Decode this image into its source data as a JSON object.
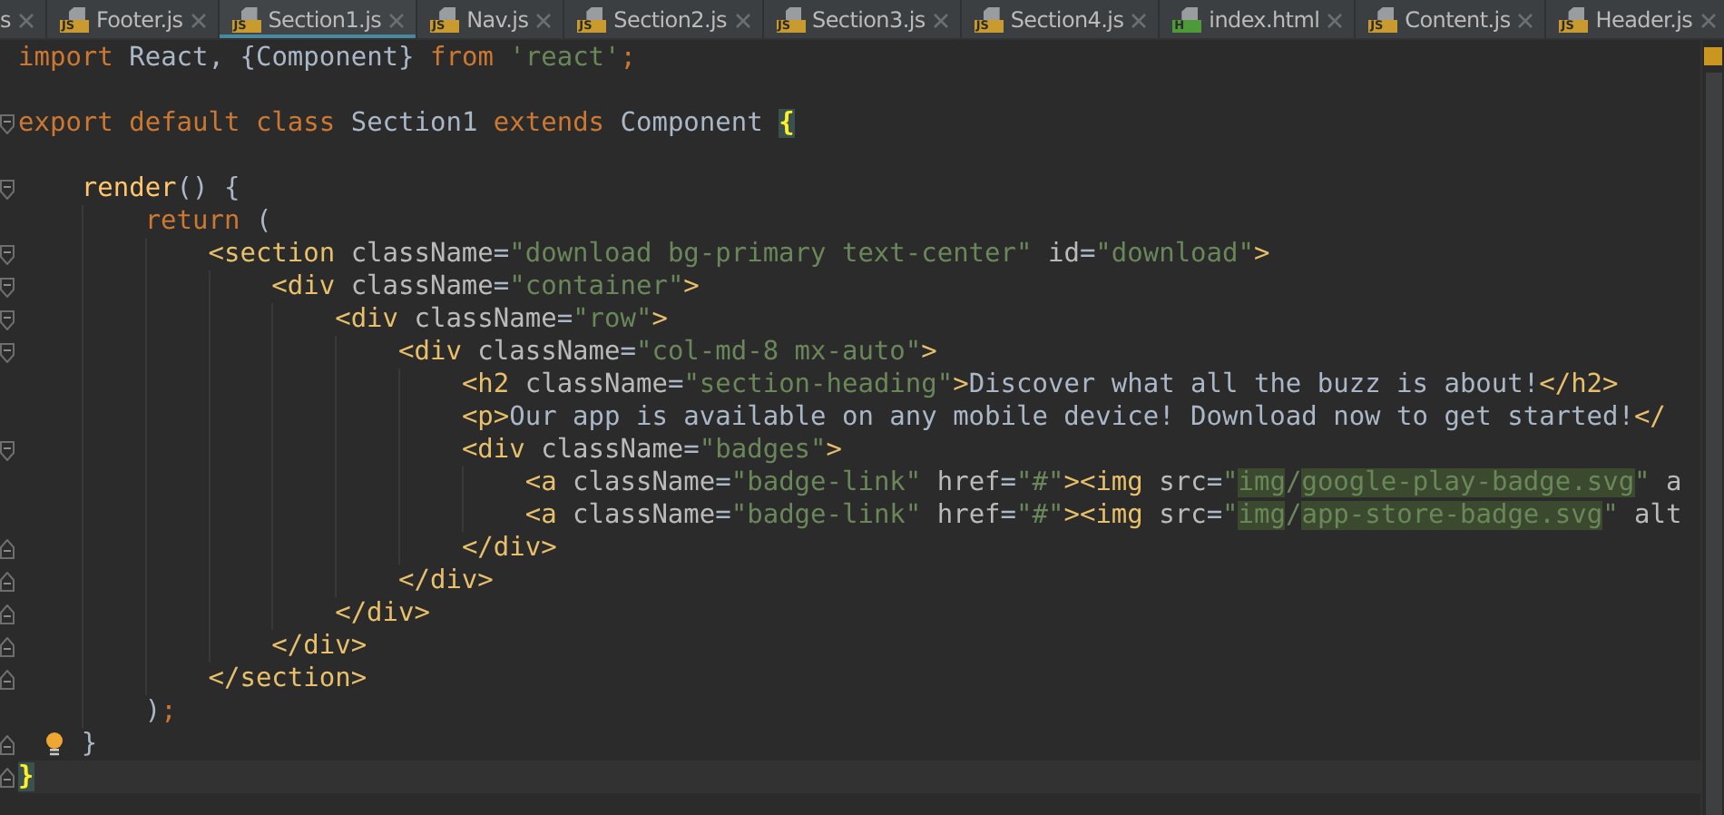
{
  "tabs": [
    {
      "label": "s",
      "kind": "none",
      "selected": false
    },
    {
      "label": "Footer.js",
      "kind": "js",
      "badge": "JS",
      "selected": false
    },
    {
      "label": "Section1.js",
      "kind": "js",
      "badge": "JS",
      "selected": true
    },
    {
      "label": "Nav.js",
      "kind": "js",
      "badge": "JS",
      "selected": false
    },
    {
      "label": "Section2.js",
      "kind": "js",
      "badge": "JS",
      "selected": false
    },
    {
      "label": "Section3.js",
      "kind": "js",
      "badge": "JS",
      "selected": false
    },
    {
      "label": "Section4.js",
      "kind": "js",
      "badge": "JS",
      "selected": false
    },
    {
      "label": "index.html",
      "kind": "html",
      "badge": "H",
      "selected": false
    },
    {
      "label": "Content.js",
      "kind": "js",
      "badge": "JS",
      "selected": false
    },
    {
      "label": "Header.js",
      "kind": "js",
      "badge": "JS",
      "selected": false
    }
  ],
  "lines": [
    {
      "kind": "plain",
      "bulb": false,
      "current": false,
      "tokens": [
        {
          "kind": "keyword",
          "text": "import"
        },
        {
          "kind": "plain",
          "text": " React, {Component} "
        },
        {
          "kind": "keyword",
          "text": "from"
        },
        {
          "kind": "string",
          "text": " 'react'"
        },
        {
          "kind": "keyword",
          "text": ";"
        }
      ]
    },
    {
      "kind": "plain",
      "bulb": false,
      "current": false
    },
    {
      "kind": "fold-start",
      "bulb": false,
      "current": false,
      "tokens": [
        {
          "kind": "keyword",
          "text": "export default class"
        },
        {
          "kind": "plain",
          "text": " Section1 "
        },
        {
          "kind": "keyword",
          "text": "extends"
        },
        {
          "kind": "plain",
          "text": " Component "
        },
        {
          "kind": "brace",
          "text": "{"
        }
      ]
    },
    {
      "kind": "plain",
      "bulb": false,
      "current": false
    },
    {
      "kind": "fold-start",
      "bulb": false,
      "current": false,
      "tokens": [
        {
          "kind": "function",
          "text": "    render"
        },
        {
          "kind": "plain",
          "text": "() {"
        }
      ]
    },
    {
      "kind": "plain",
      "bulb": false,
      "current": false,
      "tokens": [
        {
          "kind": "keyword",
          "text": "        return"
        },
        {
          "kind": "plain",
          "text": " ("
        }
      ]
    },
    {
      "kind": "fold-start",
      "bulb": false,
      "current": false,
      "tokens": [
        {
          "kind": "tag",
          "text": "            <section"
        },
        {
          "kind": "attr",
          "text": " className"
        },
        {
          "kind": "plain",
          "text": "="
        },
        {
          "kind": "string",
          "text": "\"download bg-primary text-center\""
        },
        {
          "kind": "attr",
          "text": " id"
        },
        {
          "kind": "plain",
          "text": "="
        },
        {
          "kind": "string",
          "text": "\"download\""
        },
        {
          "kind": "tag",
          "text": ">"
        }
      ]
    },
    {
      "kind": "fold-start",
      "bulb": false,
      "current": false,
      "tokens": [
        {
          "kind": "tag",
          "text": "                <div"
        },
        {
          "kind": "attr",
          "text": " className"
        },
        {
          "kind": "plain",
          "text": "="
        },
        {
          "kind": "string",
          "text": "\"container\""
        },
        {
          "kind": "tag",
          "text": ">"
        }
      ]
    },
    {
      "kind": "fold-start",
      "bulb": false,
      "current": false,
      "tokens": [
        {
          "kind": "tag",
          "text": "                    <div"
        },
        {
          "kind": "attr",
          "text": " className"
        },
        {
          "kind": "plain",
          "text": "="
        },
        {
          "kind": "string",
          "text": "\"row\""
        },
        {
          "kind": "tag",
          "text": ">"
        }
      ]
    },
    {
      "kind": "fold-start",
      "bulb": false,
      "current": false,
      "tokens": [
        {
          "kind": "tag",
          "text": "                        <div"
        },
        {
          "kind": "attr",
          "text": " className"
        },
        {
          "kind": "plain",
          "text": "="
        },
        {
          "kind": "string",
          "text": "\"col-md-8 mx-auto\""
        },
        {
          "kind": "tag",
          "text": ">"
        }
      ]
    },
    {
      "kind": "plain",
      "bulb": false,
      "current": false,
      "tokens": [
        {
          "kind": "tag",
          "text": "                            <h2"
        },
        {
          "kind": "attr",
          "text": " className"
        },
        {
          "kind": "plain",
          "text": "="
        },
        {
          "kind": "string",
          "text": "\"section-heading\""
        },
        {
          "kind": "tag",
          "text": ">"
        },
        {
          "kind": "plain",
          "text": "Discover what all the buzz is about!"
        },
        {
          "kind": "tag",
          "text": "</h2>"
        }
      ]
    },
    {
      "kind": "plain",
      "bulb": false,
      "current": false,
      "tokens": [
        {
          "kind": "tag",
          "text": "                            <p>"
        },
        {
          "kind": "plain",
          "text": "Our app is available on any mobile device! Download now to get started!"
        },
        {
          "kind": "tag",
          "text": "</"
        }
      ]
    },
    {
      "kind": "fold-start",
      "bulb": false,
      "current": false,
      "tokens": [
        {
          "kind": "tag",
          "text": "                            <div"
        },
        {
          "kind": "attr",
          "text": " className"
        },
        {
          "kind": "plain",
          "text": "="
        },
        {
          "kind": "string",
          "text": "\"badges\""
        },
        {
          "kind": "tag",
          "text": ">"
        }
      ]
    },
    {
      "kind": "plain",
      "bulb": false,
      "current": false,
      "tokens": [
        {
          "kind": "tag",
          "text": "                                <a"
        },
        {
          "kind": "attr",
          "text": " className"
        },
        {
          "kind": "plain",
          "text": "="
        },
        {
          "kind": "string",
          "text": "\"badge-link\""
        },
        {
          "kind": "attr",
          "text": " href"
        },
        {
          "kind": "plain",
          "text": "="
        },
        {
          "kind": "string",
          "text": "\"#\""
        },
        {
          "kind": "tag",
          "text": "><img"
        },
        {
          "kind": "attr",
          "text": " src"
        },
        {
          "kind": "plain",
          "text": "="
        },
        {
          "kind": "string",
          "text": "\""
        },
        {
          "kind": "match",
          "text": "img"
        },
        {
          "kind": "string",
          "text": "/"
        },
        {
          "kind": "match",
          "text": "google-play-badge.svg"
        },
        {
          "kind": "string",
          "text": "\""
        },
        {
          "kind": "attr",
          "text": " a"
        }
      ]
    },
    {
      "kind": "plain",
      "bulb": false,
      "current": false,
      "tokens": [
        {
          "kind": "tag",
          "text": "                                <a"
        },
        {
          "kind": "attr",
          "text": " className"
        },
        {
          "kind": "plain",
          "text": "="
        },
        {
          "kind": "string",
          "text": "\"badge-link\""
        },
        {
          "kind": "attr",
          "text": " href"
        },
        {
          "kind": "plain",
          "text": "="
        },
        {
          "kind": "string",
          "text": "\"#\""
        },
        {
          "kind": "tag",
          "text": "><img"
        },
        {
          "kind": "attr",
          "text": " src"
        },
        {
          "kind": "plain",
          "text": "="
        },
        {
          "kind": "string",
          "text": "\""
        },
        {
          "kind": "match",
          "text": "img"
        },
        {
          "kind": "string",
          "text": "/"
        },
        {
          "kind": "match",
          "text": "app-store-badge.svg"
        },
        {
          "kind": "string",
          "text": "\""
        },
        {
          "kind": "attr",
          "text": " alt"
        }
      ]
    },
    {
      "kind": "fold-end",
      "bulb": false,
      "current": false,
      "tokens": [
        {
          "kind": "tag",
          "text": "                            </div>"
        }
      ]
    },
    {
      "kind": "fold-end",
      "bulb": false,
      "current": false,
      "tokens": [
        {
          "kind": "tag",
          "text": "                        </div>"
        }
      ]
    },
    {
      "kind": "fold-end",
      "bulb": false,
      "current": false,
      "tokens": [
        {
          "kind": "tag",
          "text": "                    </div>"
        }
      ]
    },
    {
      "kind": "fold-end",
      "bulb": false,
      "current": false,
      "tokens": [
        {
          "kind": "tag",
          "text": "                </div>"
        }
      ]
    },
    {
      "kind": "fold-end",
      "bulb": false,
      "current": false,
      "tokens": [
        {
          "kind": "tag",
          "text": "            </section>"
        }
      ]
    },
    {
      "kind": "plain",
      "bulb": false,
      "current": false,
      "tokens": [
        {
          "kind": "plain",
          "text": "        )"
        },
        {
          "kind": "keyword",
          "text": ";"
        }
      ]
    },
    {
      "kind": "fold-end",
      "bulb": true,
      "current": false,
      "tokens": [
        {
          "kind": "plain",
          "text": "    }"
        }
      ]
    },
    {
      "kind": "fold-end",
      "bulb": false,
      "current": true,
      "tokens": [
        {
          "kind": "brace",
          "text": "}"
        }
      ]
    }
  ]
}
